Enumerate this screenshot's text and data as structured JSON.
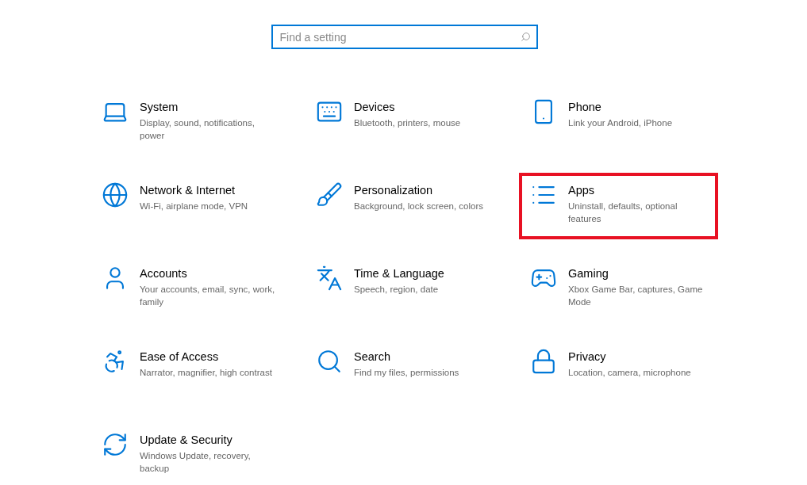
{
  "search": {
    "placeholder": "Find a setting"
  },
  "categories": [
    {
      "title": "System",
      "description": "Display, sound, notifications, power",
      "highlighted": false
    },
    {
      "title": "Devices",
      "description": "Bluetooth, printers, mouse",
      "highlighted": false
    },
    {
      "title": "Phone",
      "description": "Link your Android, iPhone",
      "highlighted": false
    },
    {
      "title": "Network & Internet",
      "description": "Wi-Fi, airplane mode, VPN",
      "highlighted": false
    },
    {
      "title": "Personalization",
      "description": "Background, lock screen, colors",
      "highlighted": false
    },
    {
      "title": "Apps",
      "description": "Uninstall, defaults, optional features",
      "highlighted": true
    },
    {
      "title": "Accounts",
      "description": "Your accounts, email, sync, work, family",
      "highlighted": false
    },
    {
      "title": "Time & Language",
      "description": "Speech, region, date",
      "highlighted": false
    },
    {
      "title": "Gaming",
      "description": "Xbox Game Bar, captures, Game Mode",
      "highlighted": false
    },
    {
      "title": "Ease of Access",
      "description": "Narrator, magnifier, high contrast",
      "highlighted": false
    },
    {
      "title": "Search",
      "description": "Find my files, permissions",
      "highlighted": false
    },
    {
      "title": "Privacy",
      "description": "Location, camera, microphone",
      "highlighted": false
    },
    {
      "title": "Update & Security",
      "description": "Windows Update, recovery, backup",
      "highlighted": false
    }
  ]
}
